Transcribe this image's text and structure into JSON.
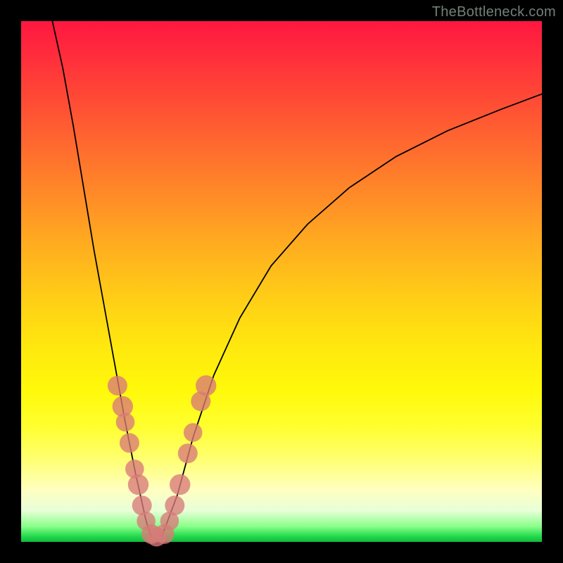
{
  "watermark": "TheBottleneck.com",
  "chart_data": {
    "type": "line",
    "title": "",
    "xlabel": "",
    "ylabel": "",
    "xlim": [
      0,
      100
    ],
    "ylim": [
      0,
      100
    ],
    "grid": false,
    "legend": false,
    "note": "Axes unlabeled; values are estimated positions read from the figure in percent of plot area (0,0 = bottom-left).",
    "curves": {
      "left": {
        "description": "Steep descending branch, from top-left down to minimum near x≈25",
        "points": [
          {
            "x": 6,
            "y": 100
          },
          {
            "x": 8,
            "y": 91
          },
          {
            "x": 10,
            "y": 80
          },
          {
            "x": 12,
            "y": 68
          },
          {
            "x": 14,
            "y": 56
          },
          {
            "x": 16,
            "y": 45
          },
          {
            "x": 18,
            "y": 34
          },
          {
            "x": 20,
            "y": 23
          },
          {
            "x": 22,
            "y": 13
          },
          {
            "x": 24,
            "y": 4
          },
          {
            "x": 25,
            "y": 1
          }
        ]
      },
      "right": {
        "description": "Rising branch with decreasing slope, from minimum near x≈27 up to right edge",
        "points": [
          {
            "x": 27,
            "y": 1
          },
          {
            "x": 30,
            "y": 9
          },
          {
            "x": 33,
            "y": 20
          },
          {
            "x": 37,
            "y": 32
          },
          {
            "x": 42,
            "y": 43
          },
          {
            "x": 48,
            "y": 53
          },
          {
            "x": 55,
            "y": 61
          },
          {
            "x": 63,
            "y": 68
          },
          {
            "x": 72,
            "y": 74
          },
          {
            "x": 82,
            "y": 79
          },
          {
            "x": 92,
            "y": 83
          },
          {
            "x": 100,
            "y": 86
          }
        ]
      }
    },
    "markers": {
      "description": "Highlighted data points (pink dots) near the valley region",
      "points": [
        {
          "x": 18.5,
          "y": 30,
          "r": 1.2
        },
        {
          "x": 19.5,
          "y": 26,
          "r": 1.3
        },
        {
          "x": 20.0,
          "y": 23,
          "r": 1.1
        },
        {
          "x": 20.8,
          "y": 19,
          "r": 1.2
        },
        {
          "x": 21.8,
          "y": 14,
          "r": 1.1
        },
        {
          "x": 22.5,
          "y": 11,
          "r": 1.3
        },
        {
          "x": 23.2,
          "y": 7,
          "r": 1.2
        },
        {
          "x": 24.0,
          "y": 4,
          "r": 1.1
        },
        {
          "x": 25.0,
          "y": 1.5,
          "r": 1.2
        },
        {
          "x": 26.0,
          "y": 1.0,
          "r": 1.2
        },
        {
          "x": 27.5,
          "y": 1.5,
          "r": 1.2
        },
        {
          "x": 28.5,
          "y": 4,
          "r": 1.1
        },
        {
          "x": 29.5,
          "y": 7,
          "r": 1.2
        },
        {
          "x": 30.5,
          "y": 11,
          "r": 1.3
        },
        {
          "x": 32.0,
          "y": 17,
          "r": 1.2
        },
        {
          "x": 33.0,
          "y": 21,
          "r": 1.1
        },
        {
          "x": 34.5,
          "y": 27,
          "r": 1.2
        },
        {
          "x": 35.5,
          "y": 30,
          "r": 1.3
        }
      ]
    }
  }
}
